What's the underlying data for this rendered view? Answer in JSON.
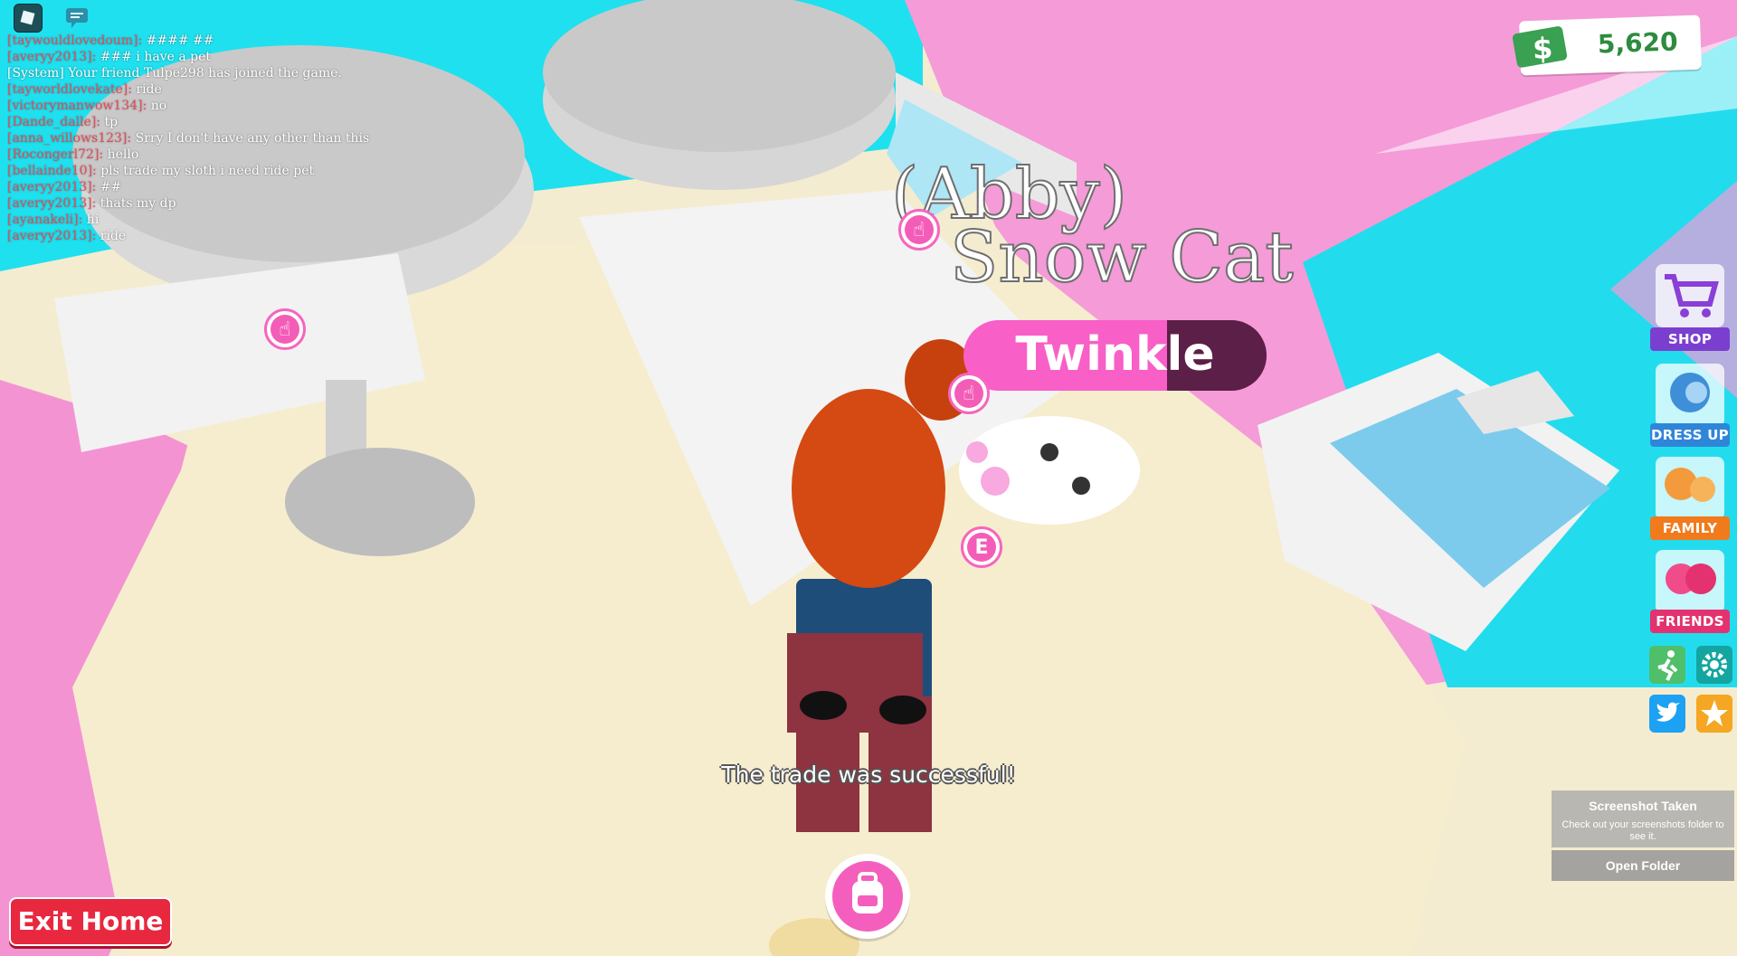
{
  "chat": {
    "messages": [
      {
        "user": "[taywouldlovedoum]:",
        "text": "#### ##"
      },
      {
        "user": "[averyy2013]:",
        "text": "### i have a pet"
      },
      {
        "user": "",
        "text": "[System] Your friend Tulpe298 has joined the game."
      },
      {
        "user": "[tayworldlovekate]:",
        "text": "ride"
      },
      {
        "user": "[victorymanwow134]:",
        "text": "no"
      },
      {
        "user": "[Dande_dalle]:",
        "text": "tp"
      },
      {
        "user": "[anna_willows123]:",
        "text": "Srry I don't have any other than this"
      },
      {
        "user": "[Rocongerl72]:",
        "text": "hello"
      },
      {
        "user": "[bellainde10]:",
        "text": "pls trade my sloth i need ride pet"
      },
      {
        "user": "[averyy2013]:",
        "text": "##"
      },
      {
        "user": "[averyy2013]:",
        "text": "thats my dp"
      },
      {
        "user": "[ayanakeli]:",
        "text": "hi"
      },
      {
        "user": "[averyy2013]:",
        "text": "ride"
      }
    ]
  },
  "currency": {
    "value": "5,620",
    "icon": "dollar-bill-icon"
  },
  "menu": {
    "shop": "SHOP",
    "dress_up": "DRESS UP",
    "family": "FAMILY",
    "friends": "FRIENDS"
  },
  "pet": {
    "owner": "(Abby)",
    "species": "Snow Cat",
    "name": "Twinkle"
  },
  "interact_key": "E",
  "status_message": "The trade was successful!",
  "exit_home": "Exit Home",
  "toast": {
    "title": "Screenshot Taken",
    "text": "Check out your screenshots folder to see it.",
    "button": "Open Folder"
  },
  "colors": {
    "pink": "#f35db8",
    "cyan": "#1de0ee",
    "exit_red": "#e8283f",
    "money_green": "#2e8b3f"
  }
}
